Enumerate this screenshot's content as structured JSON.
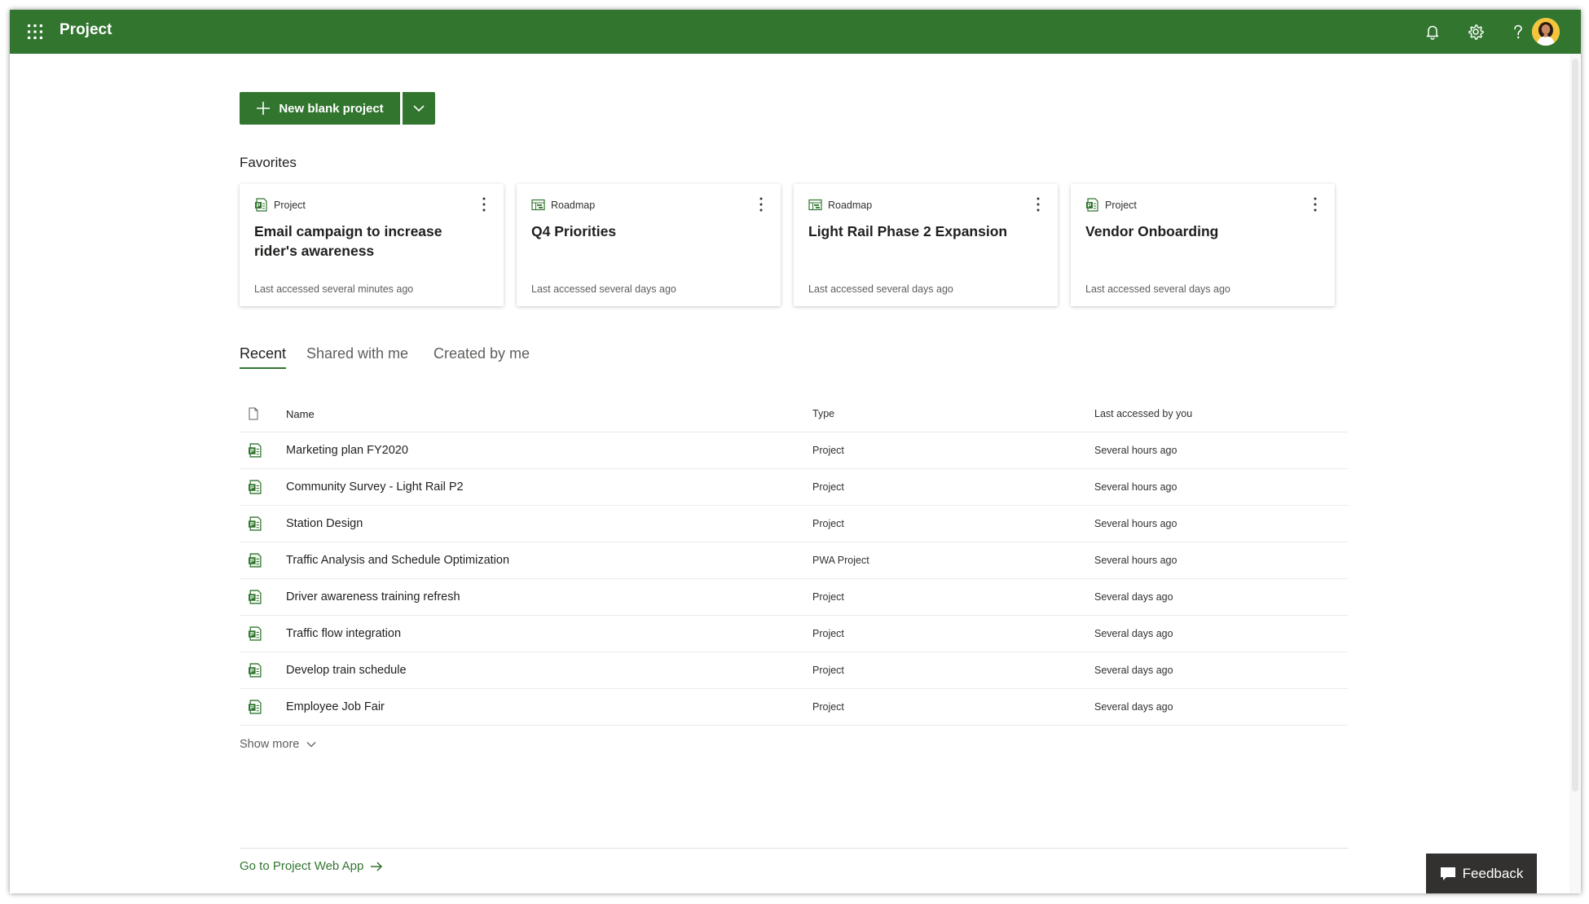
{
  "header": {
    "app_title": "Project",
    "icons": [
      "waffle-icon",
      "bell-icon",
      "gear-icon",
      "help-icon",
      "avatar"
    ],
    "brand_color": "#31752f"
  },
  "toolbar": {
    "new_label": "New blank project"
  },
  "favorites": {
    "title": "Favorites",
    "cards": [
      {
        "type": "Project",
        "title": "Email campaign to increase rider's awareness",
        "access": "Last accessed several minutes ago"
      },
      {
        "type": "Roadmap",
        "title": "Q4 Priorities",
        "access": "Last accessed several days ago"
      },
      {
        "type": "Roadmap",
        "title": "Light Rail Phase 2 Expansion",
        "access": "Last accessed several days ago"
      },
      {
        "type": "Project",
        "title": "Vendor Onboarding",
        "access": "Last accessed several days ago"
      }
    ]
  },
  "tabs": [
    "Recent",
    "Shared with me",
    "Created by me"
  ],
  "active_tab": "Recent",
  "table": {
    "columns": [
      "Name",
      "Type",
      "Last accessed by you"
    ],
    "rows": [
      {
        "name": "Marketing plan FY2020",
        "type": "Project",
        "last": "Several hours ago"
      },
      {
        "name": "Community Survey - Light Rail P2",
        "type": "Project",
        "last": "Several hours ago"
      },
      {
        "name": "Station Design",
        "type": "Project",
        "last": "Several hours ago"
      },
      {
        "name": "Traffic Analysis and Schedule Optimization",
        "type": "PWA Project",
        "last": "Several hours ago"
      },
      {
        "name": "Driver awareness training refresh",
        "type": "Project",
        "last": "Several days ago"
      },
      {
        "name": "Traffic flow integration",
        "type": "Project",
        "last": "Several days ago"
      },
      {
        "name": "Develop train schedule",
        "type": "Project",
        "last": "Several days ago"
      },
      {
        "name": "Employee Job Fair",
        "type": "Project",
        "last": "Several days ago"
      }
    ]
  },
  "show_more": "Show more",
  "footer": {
    "pwa_link": "Go to Project Web App"
  },
  "feedback": "Feedback"
}
